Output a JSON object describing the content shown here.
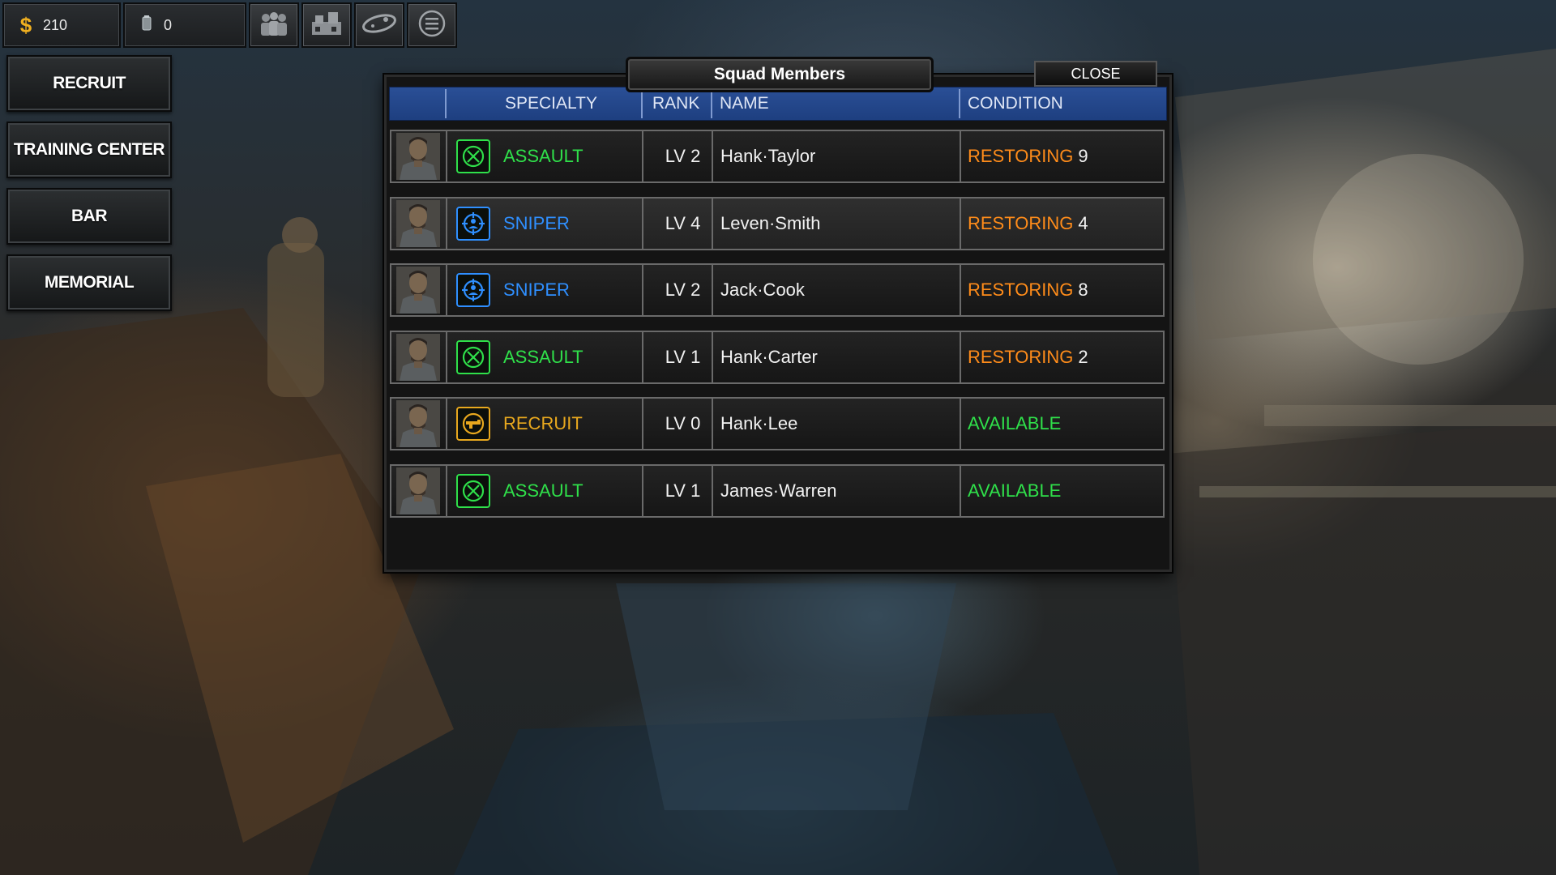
{
  "resources": {
    "money_value": "210",
    "parts_value": "0",
    "money_icon": "dollar-icon",
    "parts_icon": "parts-canister-icon"
  },
  "toolbar": [
    {
      "name": "squad-icon"
    },
    {
      "name": "base-icon"
    },
    {
      "name": "world-map-icon"
    },
    {
      "name": "menu-icon"
    }
  ],
  "left_menu": {
    "recruit": "RECRUIT",
    "training_center": "TRAINING CENTER",
    "bar": "BAR",
    "memorial": "MEMORIAL"
  },
  "panel": {
    "title": "Squad Members",
    "close_label": "CLOSE",
    "headers": {
      "specialty": "SPECIALTY",
      "rank": "RANK",
      "name": "NAME",
      "condition": "CONDITION"
    }
  },
  "colors": {
    "assault": "#2fe04a",
    "sniper": "#2f8fff",
    "recruit": "#e8a81e",
    "restoring": "#ff8c1a",
    "available": "#2fe04a",
    "header_blue": "#2a4f96"
  },
  "squad": [
    {
      "specialty": "ASSAULT",
      "specialty_key": "assault",
      "rank": "LV 2",
      "name": "Hank·Taylor",
      "condition": "RESTORING",
      "condition_key": "restoring",
      "days": "9"
    },
    {
      "specialty": "SNIPER",
      "specialty_key": "sniper",
      "rank": "LV 4",
      "name": "Leven·Smith",
      "condition": "RESTORING",
      "condition_key": "restoring",
      "days": "4"
    },
    {
      "specialty": "SNIPER",
      "specialty_key": "sniper",
      "rank": "LV 2",
      "name": "Jack·Cook",
      "condition": "RESTORING",
      "condition_key": "restoring",
      "days": "8"
    },
    {
      "specialty": "ASSAULT",
      "specialty_key": "assault",
      "rank": "LV 1",
      "name": "Hank·Carter",
      "condition": "RESTORING",
      "condition_key": "restoring",
      "days": "2"
    },
    {
      "specialty": "RECRUIT",
      "specialty_key": "recruit",
      "rank": "LV 0",
      "name": "Hank·Lee",
      "condition": "AVAILABLE",
      "condition_key": "available",
      "days": ""
    },
    {
      "specialty": "ASSAULT",
      "specialty_key": "assault",
      "rank": "LV 1",
      "name": "James·Warren",
      "condition": "AVAILABLE",
      "condition_key": "available",
      "days": ""
    }
  ]
}
